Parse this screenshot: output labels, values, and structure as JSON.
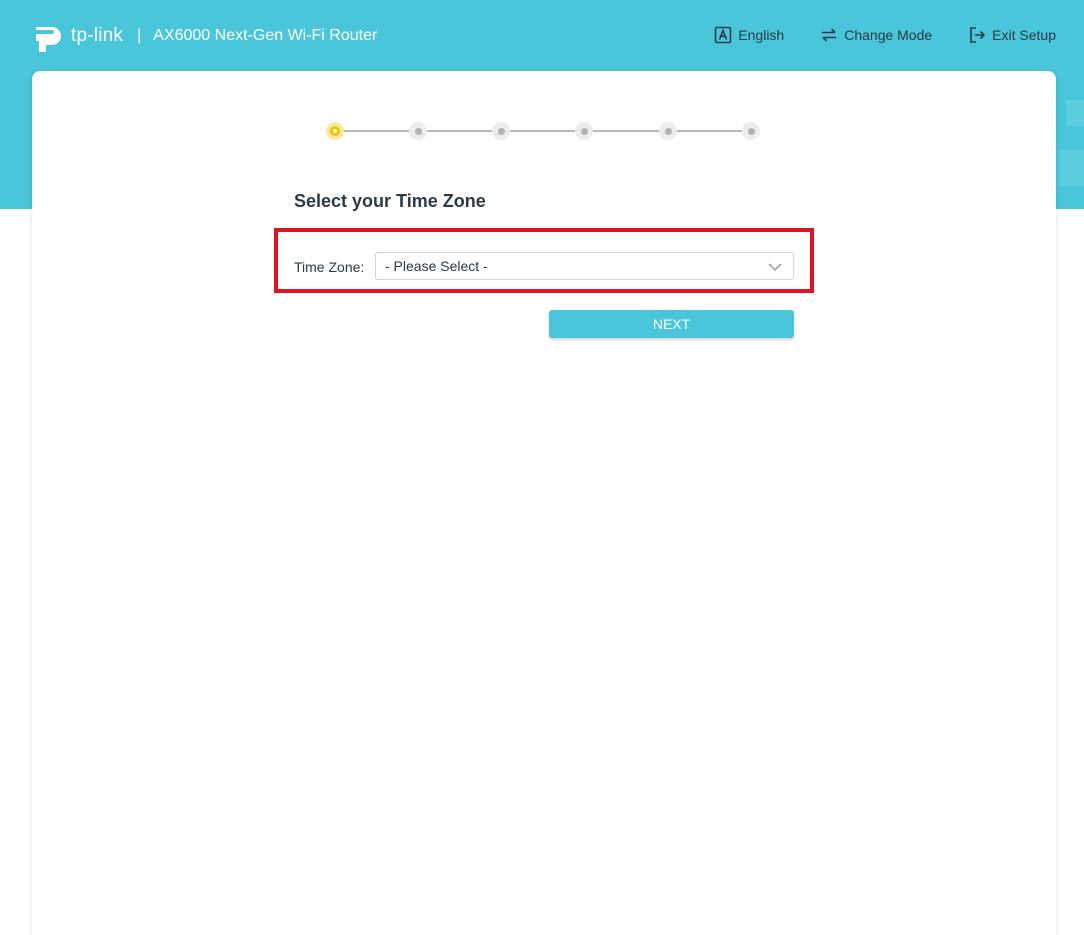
{
  "header": {
    "brand": "tp-link",
    "separator": "|",
    "model": "AX6000 Next-Gen Wi-Fi Router",
    "actions": [
      {
        "label": "English",
        "icon": "language-icon"
      },
      {
        "label": "Change Mode",
        "icon": "switch-mode-icon"
      },
      {
        "label": "Exit Setup",
        "icon": "exit-icon"
      }
    ]
  },
  "stepper": {
    "total_steps": 6,
    "current_step": 1
  },
  "main": {
    "title": "Select your Time Zone",
    "time_zone_label": "Time Zone:",
    "time_zone_value": "- Please Select -",
    "next_label": "NEXT"
  },
  "colors": {
    "brand": "#4ac6db",
    "highlight": "#e0141e",
    "active_step": "#f5c400"
  }
}
